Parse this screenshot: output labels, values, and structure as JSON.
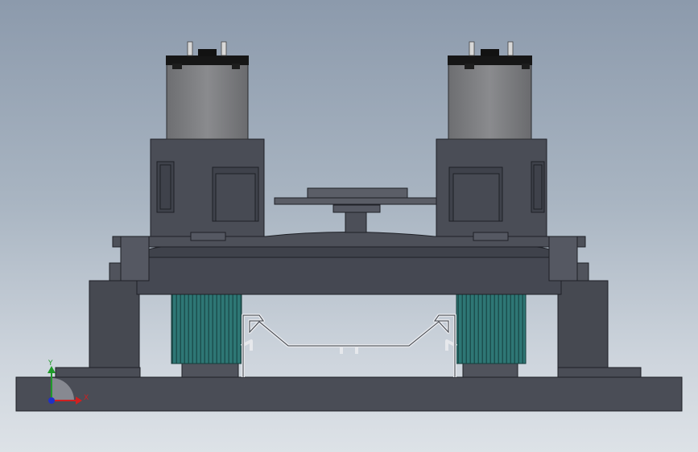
{
  "viewport": {
    "background_top": "#8c9aac",
    "background_bottom": "#dde2e7"
  },
  "model": {
    "body_color": "#4b4e58",
    "body_dark": "#3f424b",
    "motor_color": "#7c7d80",
    "motor_cap_color": "#1a1a1a",
    "gear_color": "#2f7a78",
    "rail_color": "#e4e6ea"
  },
  "triad": {
    "x_label": "X",
    "y_label": "Y",
    "x_color": "#d02020",
    "y_color": "#1f9a2a",
    "z_color": "#2030c8"
  }
}
